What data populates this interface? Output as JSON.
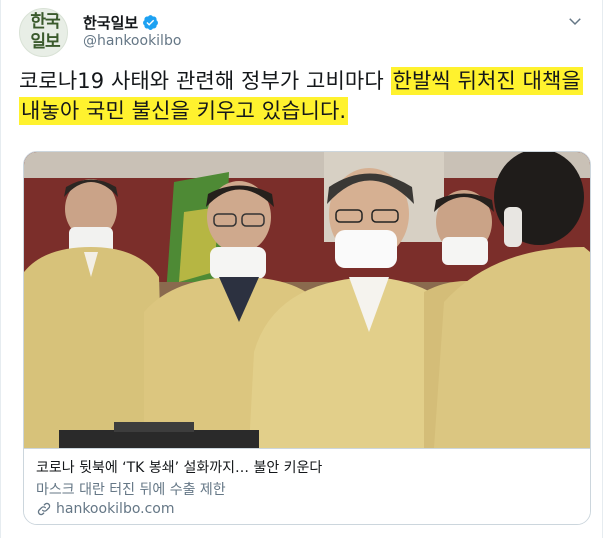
{
  "account": {
    "avatar_text_line1": "한국",
    "avatar_text_line2": "일보",
    "display_name": "한국일보",
    "handle": "@hankookilbo",
    "verified": true
  },
  "tweet": {
    "text_plain": "코로나19 사태와 관련해 정부가 고비마다 ",
    "text_highlighted": "한발씩 뒤처진 대책을 내놓아 국민 불신을 키우고 있습니다."
  },
  "card": {
    "title": "코로나 뒷북에 ‘TK 봉쇄’ 설화까지… 불안 키운다",
    "description": "마스크 대란 터진 뒤에 수출 제한",
    "domain": "hankookilbo.com",
    "image_description_icon": "news-photo"
  },
  "colors": {
    "highlight": "#fff22e",
    "verified_blue": "#1da1f2",
    "secondary_text": "#657786",
    "border": "#ccd6dd"
  },
  "icons": [
    "verified-badge-icon",
    "chevron-down-icon",
    "link-icon"
  ]
}
